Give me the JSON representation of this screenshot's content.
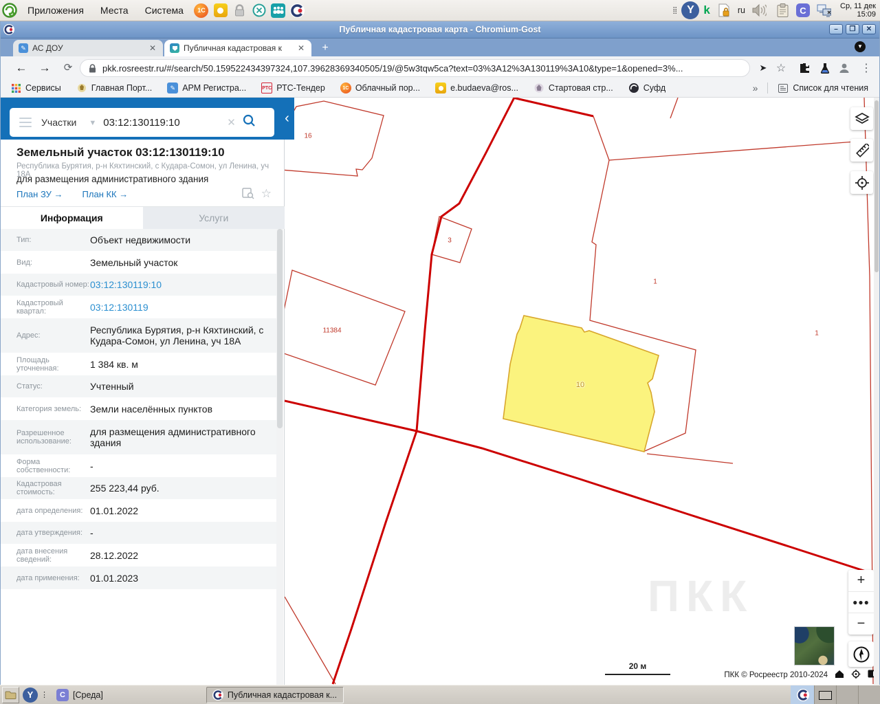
{
  "desktop": {
    "top_panel": {
      "menus": [
        {
          "label": "Приложения"
        },
        {
          "label": "Места"
        },
        {
          "label": "Система"
        }
      ],
      "language": "ru",
      "clock": {
        "date": "Ср, 11 дек",
        "time": "15:09"
      }
    },
    "taskbar": {
      "items": [
        {
          "label": "[Среда]"
        },
        {
          "label": "Публичная кадастровая к..."
        }
      ]
    }
  },
  "browser": {
    "window_title": "Публичная кадастровая карта - Chromium-Gost",
    "tabs": [
      {
        "label": "АС ДОУ"
      },
      {
        "label": "Публичная кадастровая к"
      }
    ],
    "new_tab": "+",
    "url": "pkk.rosreestr.ru/#/search/50.159522434397324,107.39628369340505/19/@5w3tqw5ca?text=03%3A12%3A130119%3A10&type=1&opened=3%...",
    "bookmarks": [
      {
        "label": "Сервисы"
      },
      {
        "label": "Главная Порт..."
      },
      {
        "label": "АРМ Регистра..."
      },
      {
        "label": "РТС-Тендер"
      },
      {
        "label": "Облачный пор..."
      },
      {
        "label": "e.budaeva@ros..."
      },
      {
        "label": "Стартовая стр..."
      },
      {
        "label": "Суфд"
      }
    ],
    "bookmarks_overflow": "»",
    "reading_list": "Список для чтения"
  },
  "panel": {
    "search": {
      "category": "Участки",
      "query": "03:12:130119:10"
    },
    "object": {
      "title": "Земельный участок 03:12:130119:10",
      "address": "Республика Бурятия, р-н Кяхтинский, с Кудара-Сомон, ул Ленина, уч 18А",
      "usage": "для размещения административного здания",
      "link_plan_zu": "План ЗУ →",
      "link_plan_kk": "План КК →"
    },
    "tabs": {
      "info": "Информация",
      "services": "Услуги"
    },
    "rows": [
      {
        "label": "Тип:",
        "value": "Объект недвижимости"
      },
      {
        "label": "Вид:",
        "value": "Земельный участок"
      },
      {
        "label": "Кадастровый номер:",
        "value": "03:12:130119:10"
      },
      {
        "label": "Кадастровый квартал:",
        "value": "03:12:130119"
      },
      {
        "label": "Адрес:",
        "value": "Республика Бурятия, р-н Кяхтинский, с Кудара-Сомон, ул Ленина, уч 18А"
      },
      {
        "label": "Площадь уточненная:",
        "value": "1 384 кв. м"
      },
      {
        "label": "Статус:",
        "value": "Учтенный"
      },
      {
        "label": "Категория земель:",
        "value": "Земли населённых пунктов"
      },
      {
        "label": "Разрешенное использование:",
        "value": "для размещения административного здания"
      },
      {
        "label": "Форма собственности:",
        "value": "-"
      },
      {
        "label": "Кадастровая стоимость:",
        "value": "255 223,44 руб."
      },
      {
        "label": "дата определения:",
        "value": "01.01.2022"
      },
      {
        "label": "дата утверждения:",
        "value": "-"
      },
      {
        "label": "дата внесения сведений:",
        "value": "28.12.2022"
      },
      {
        "label": "дата применения:",
        "value": "01.01.2023"
      }
    ]
  },
  "map": {
    "labels": [
      {
        "text": "16"
      },
      {
        "text": "3"
      },
      {
        "text": "11384"
      },
      {
        "text": "1"
      },
      {
        "text": "1"
      },
      {
        "text": "10"
      }
    ],
    "scale": "20 м",
    "copyright": "ПКК © Росреестр 2010-2024",
    "watermark": "ПКК"
  },
  "colors": {
    "accent_blue": "#1470b8",
    "link_blue": "#2b8fd0",
    "parcel_line": "#c0392b",
    "boundary_line": "#cc0000",
    "highlight_fill": "#fbf37e",
    "highlight_stroke": "#d8a62b"
  }
}
